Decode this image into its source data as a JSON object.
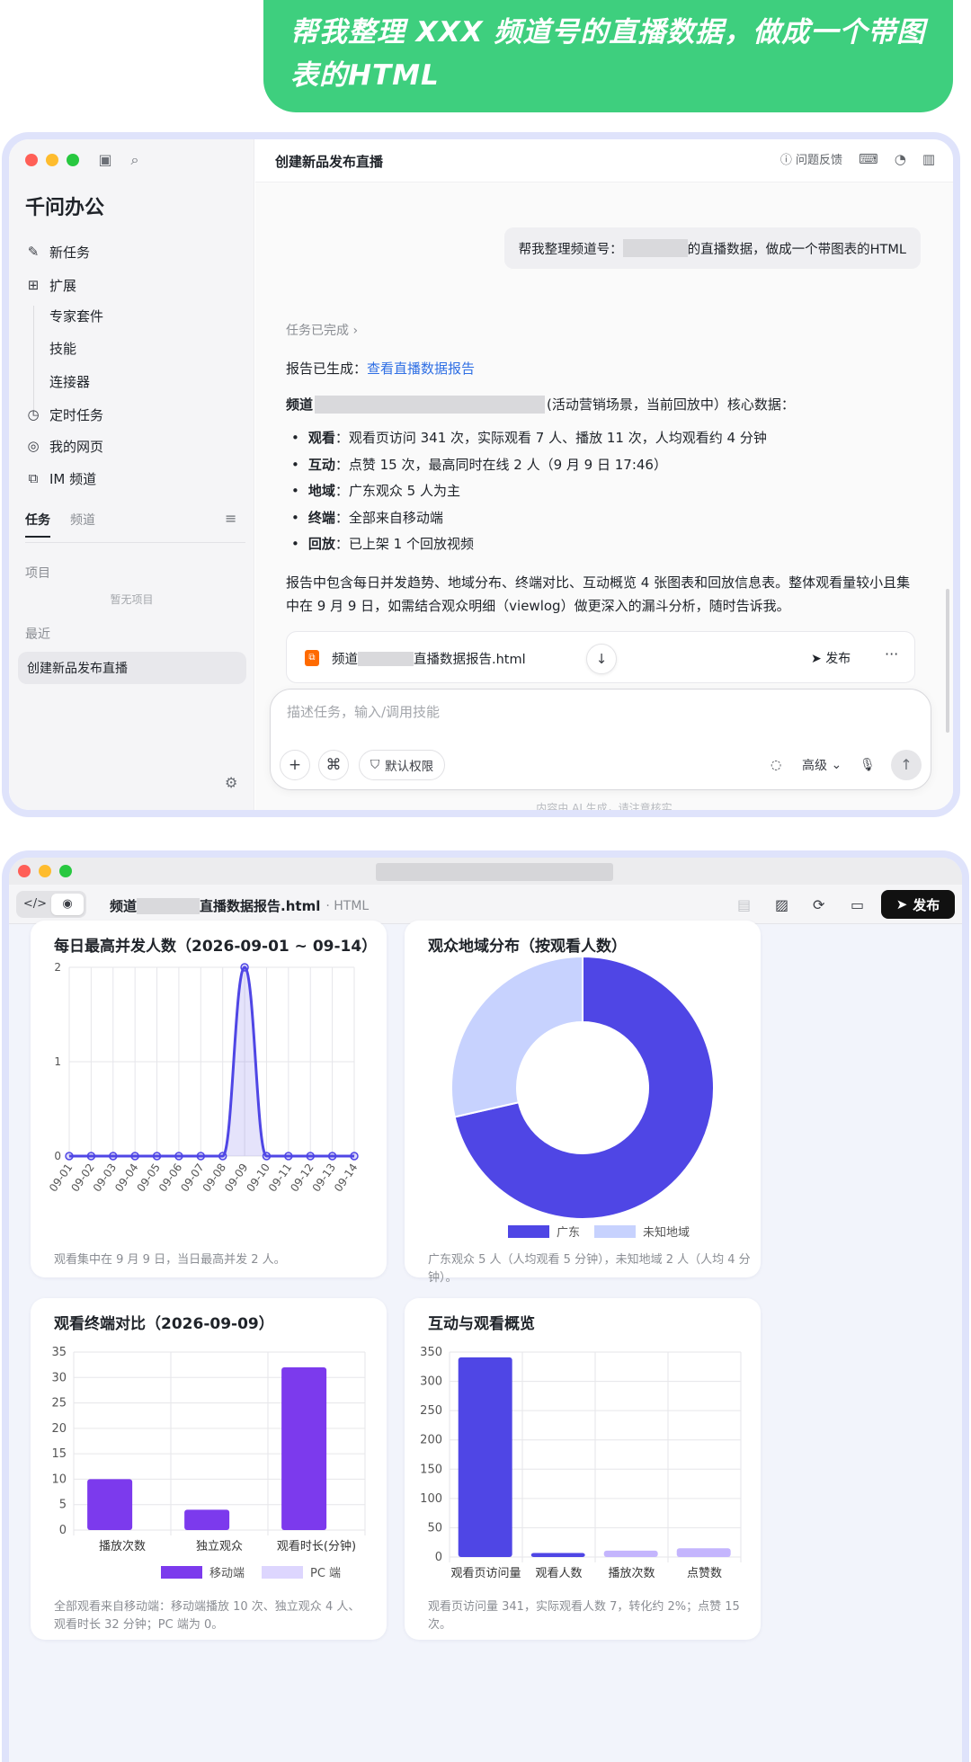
{
  "prompt_bubble": "帮我整理 XXX 频道号的直播数据，做成一个带图表的HTML",
  "sidebar": {
    "brand": "千问办公",
    "nav": [
      {
        "icon": "edit-icon",
        "label": "新任务"
      },
      {
        "icon": "grid-plus-icon",
        "label": "扩展"
      }
    ],
    "ext_sub": [
      "专家套件",
      "技能",
      "连接器"
    ],
    "nav2": [
      {
        "icon": "clock-icon",
        "label": "定时任务"
      },
      {
        "icon": "globe-icon",
        "label": "我的网页"
      },
      {
        "icon": "im-icon",
        "label": "IM 频道"
      }
    ],
    "tabs": [
      "任务",
      "频道"
    ],
    "projects_label": "项目",
    "projects_empty": "暂无项目",
    "recent_label": "最近",
    "recent_item": "创建新品发布直播"
  },
  "main": {
    "title": "创建新品发布直播",
    "feedback": "问题反馈",
    "user_msg_prefix": "帮我整理频道号：",
    "user_msg_suffix": "的直播数据，做成一个带图表的HTML",
    "task_done": "任务已完成",
    "report_prefix": "报告已生成：",
    "report_link": "查看直播数据报告",
    "channel_label": "频道",
    "channel_desc": "(活动营销场景，当前回放中）核心数据：",
    "bullets": [
      {
        "key": "观看",
        "text": "：观看页访问 341 次，实际观看 7 人、播放 11 次，人均观看约 4 分钟"
      },
      {
        "key": "互动",
        "text": "：点赞 15 次，最高同时在线 2 人（9 月 9 日 17:46）"
      },
      {
        "key": "地域",
        "text": "：广东观众 5 人为主"
      },
      {
        "key": "终端",
        "text": "：全部来自移动端"
      },
      {
        "key": "回放",
        "text": "：已上架 1 个回放视频"
      }
    ],
    "summary": "报告中包含每日并发趋势、地域分布、终端对比、互动概览 4 张图表和回放信息表。整体观看量较小且集中在 9 月 9 日，如需结合观众明细（viewlog）做更深入的漏斗分析，随时告诉我。",
    "file_prefix": "频道",
    "file_suffix": "直播数据报告.html",
    "publish": "发布",
    "input_placeholder": "描述任务，输入/调用技能",
    "perm_label": "默认权限",
    "mode_label": "高级",
    "ai_note": "内容由 AI 生成，请注意核实"
  },
  "viewer": {
    "file_prefix": "频道",
    "file_suffix": "直播数据报告.html",
    "file_type": "· HTML",
    "publish": "发布"
  },
  "cards": [
    {
      "title": "每日最高并发人数（2026-09-01 ~ 09-14）",
      "note": "观看集中在 9 月 9 日，当日最高并发 2 人。"
    },
    {
      "title": "观众地域分布（按观看人数）",
      "note": "广东观众 5 人（人均观看 5 分钟），未知地域 2 人（人均 4 分钟）。"
    },
    {
      "title": "观看终端对比（2026-09-09）",
      "note": "全部观看来自移动端：移动端播放 10 次、独立观众 4 人、观看时长 32 分钟；PC 端为 0。"
    },
    {
      "title": "互动与观看概览",
      "note": "观看页访问量 341，实际观看人数 7，转化约 2%；点赞 15 次。"
    }
  ],
  "colors": {
    "accent": "#4f46e5",
    "purple": "#7c3aed",
    "light": "#c7d2fe",
    "lavender": "#c4b5fd",
    "green": "#3ecf7e"
  },
  "chart_data": [
    {
      "type": "line",
      "title": "每日最高并发人数（2026-09-01 ~ 09-14）",
      "categories": [
        "09-01",
        "09-02",
        "09-03",
        "09-04",
        "09-05",
        "09-06",
        "09-07",
        "09-08",
        "09-09",
        "09-10",
        "09-11",
        "09-12",
        "09-13",
        "09-14"
      ],
      "values": [
        0,
        0,
        0,
        0,
        0,
        0,
        0,
        0,
        2,
        0,
        0,
        0,
        0,
        0
      ],
      "ylim": [
        0,
        2
      ],
      "yticks": [
        0,
        1,
        2
      ],
      "grid": true
    },
    {
      "type": "pie",
      "title": "观众地域分布（按观看人数）",
      "labels": [
        "广东",
        "未知地域"
      ],
      "values": [
        5,
        2
      ],
      "legend": "bottom"
    },
    {
      "type": "bar",
      "title": "观看终端对比（2026-09-09）",
      "categories": [
        "播放次数",
        "独立观众",
        "观看时长(分钟)"
      ],
      "series": [
        {
          "name": "移动端",
          "values": [
            10,
            4,
            32
          ]
        },
        {
          "name": "PC 端",
          "values": [
            0,
            0,
            0
          ]
        }
      ],
      "ylim": [
        0,
        35
      ],
      "yticks": [
        0,
        5,
        10,
        15,
        20,
        25,
        30,
        35
      ],
      "legend": "bottom"
    },
    {
      "type": "bar",
      "title": "互动与观看概览",
      "categories": [
        "观看页访问量",
        "观看人数",
        "播放次数",
        "点赞数"
      ],
      "values": [
        341,
        7,
        11,
        15
      ],
      "ylim": [
        0,
        350
      ],
      "yticks": [
        0,
        50,
        100,
        150,
        200,
        250,
        300,
        350
      ]
    }
  ]
}
